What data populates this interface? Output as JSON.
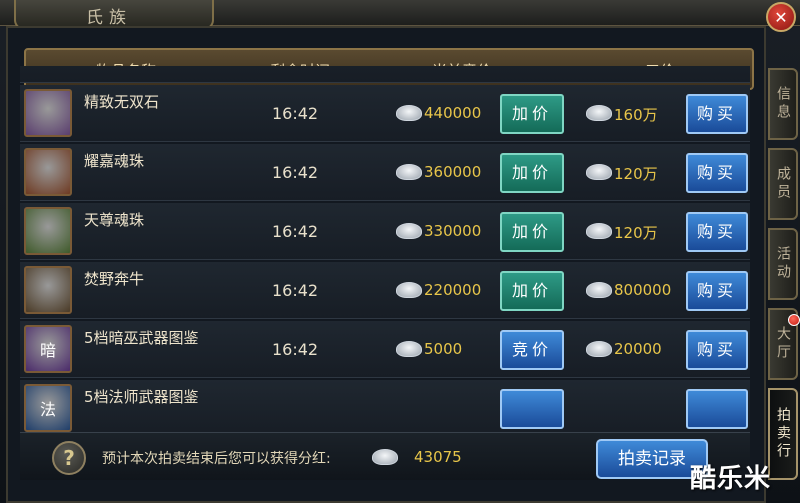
{
  "window": {
    "title": "氏族",
    "close_icon": "close-icon"
  },
  "table": {
    "headers": [
      "物品名称",
      "剩余时间",
      "当前竞价",
      "一口价"
    ],
    "rows": [
      {
        "name": "精致无双石",
        "time": "16:42",
        "bid": "440000",
        "bid_button": "加价",
        "bid_style": "green",
        "buyout": "160万",
        "buy_button": "购买",
        "icon": "purple-gem-icon",
        "thumb_color": "#5a3e6e"
      },
      {
        "name": "耀嘉魂珠",
        "time": "16:42",
        "bid": "360000",
        "bid_button": "加价",
        "bid_style": "green",
        "buyout": "120万",
        "buy_button": "购买",
        "icon": "warrior-face-icon",
        "thumb_color": "#6e3a22"
      },
      {
        "name": "天尊魂珠",
        "time": "16:42",
        "bid": "330000",
        "bid_button": "加价",
        "bid_style": "green",
        "buyout": "120万",
        "buy_button": "购买",
        "icon": "green-face-icon",
        "thumb_color": "#3f5a2a"
      },
      {
        "name": "焚野奔牛",
        "time": "16:42",
        "bid": "220000",
        "bid_button": "加价",
        "bid_style": "green",
        "buyout": "800000",
        "buy_button": "购买",
        "icon": "bull-mount-icon",
        "thumb_color": "#4a3a26"
      },
      {
        "name": "5档暗巫武器图鉴",
        "time": "16:42",
        "bid": "5000",
        "bid_button": "竞价",
        "bid_style": "blue",
        "buyout": "20000",
        "buy_button": "购买",
        "icon": "dark-scroll-icon",
        "thumb_color": "#4a2a6a",
        "thumb_glyph": "暗"
      },
      {
        "name": "5档法师武器图鉴",
        "time": "",
        "bid": "",
        "bid_button": "",
        "bid_style": "blue",
        "buyout": "",
        "buy_button": "",
        "icon": "mage-scroll-icon",
        "thumb_color": "#1f3e6a",
        "thumb_glyph": "法"
      }
    ]
  },
  "footer": {
    "help_icon": "question-icon",
    "help_glyph": "?",
    "text": "预计本次拍卖结束后您可以获得分红:",
    "dividend": "43075",
    "record_button": "拍卖记录"
  },
  "side_tabs": [
    {
      "label": "信息",
      "active": false
    },
    {
      "label": "成员",
      "active": false
    },
    {
      "label": "活动",
      "active": false
    },
    {
      "label": "大厅",
      "active": false
    },
    {
      "label": "拍卖行",
      "active": true
    }
  ],
  "watermark": "酷乐米",
  "colors": {
    "gold_text": "#e8c64a",
    "green_button": "#2e9a86",
    "blue_button": "#1a4b99",
    "header_bar": "#5a4a30"
  }
}
